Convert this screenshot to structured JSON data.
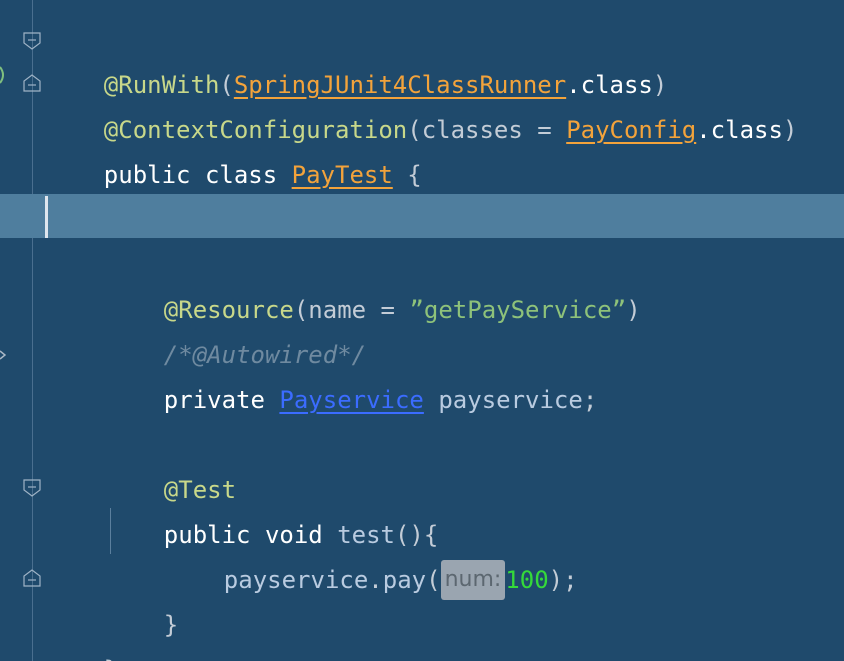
{
  "editor": {
    "lines": {
      "l1": {
        "annot": "@RunWith",
        "open": "(",
        "class_ref": "SpringJUnit4ClassRunner",
        "dot_class": ".class",
        "close": ")"
      },
      "l2": {
        "annot": "@ContextConfiguration",
        "open": "(",
        "param": "classes = ",
        "class_ref": "PayConfig",
        "dot_class": ".class",
        "close": ")"
      },
      "l3": {
        "kw": "public class ",
        "class_name": "PayTest",
        "brace": " {"
      },
      "l5": {
        "annot": "@Resource",
        "open": "(",
        "param": "name = ",
        "string": "”getPayService”",
        "close": ")"
      },
      "l6": {
        "comment": "/*@Autowired*/"
      },
      "l7": {
        "kw": "private ",
        "type": "Payservice",
        "ident": " payservice",
        "semi": ";"
      },
      "l9": {
        "annot": "@Test"
      },
      "l10": {
        "kw": "public void ",
        "method": "test",
        "parens": "()",
        "brace": "{"
      },
      "l11": {
        "obj": "payservice",
        "dot": ".",
        "call": "pay",
        "open": "(",
        "hint": "num:",
        "arg": "100",
        "close": ");"
      },
      "l12": {
        "brace": "}"
      },
      "l13": {
        "brace": "}"
      }
    }
  },
  "icons": [
    "fold-open-icon",
    "fold-close-icon",
    "run-gutter-marker-icon"
  ],
  "colors": {
    "background": "#1f4a6c",
    "current_line": "#4f7e9e",
    "annotation": "#c8d88a",
    "class_reference": "#f3a33b",
    "type_link": "#3b6cff",
    "string": "#8ec27a",
    "comment": "#6f8aa0",
    "number": "#35d93a"
  }
}
